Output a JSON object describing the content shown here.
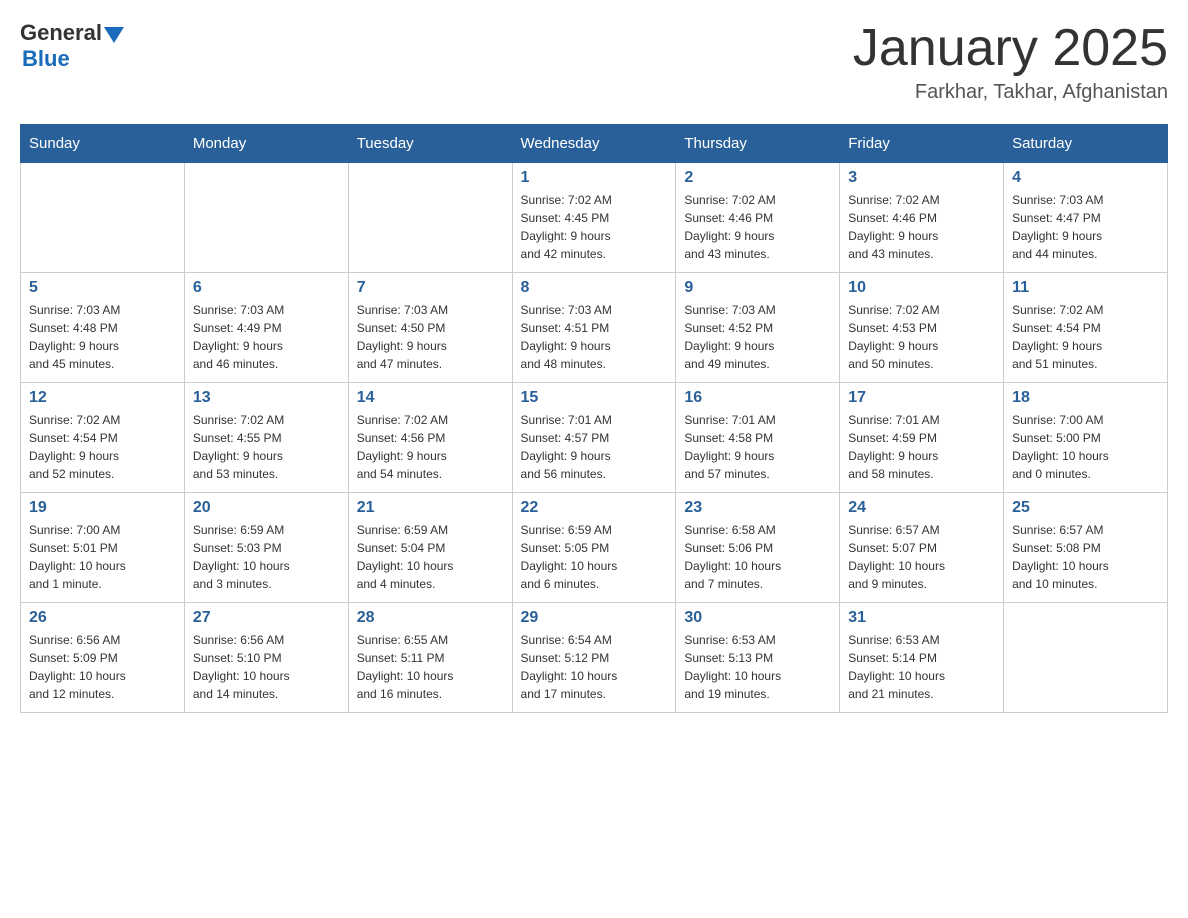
{
  "header": {
    "logo_general": "General",
    "logo_blue": "Blue",
    "month_title": "January 2025",
    "location": "Farkhar, Takhar, Afghanistan"
  },
  "days_of_week": [
    "Sunday",
    "Monday",
    "Tuesday",
    "Wednesday",
    "Thursday",
    "Friday",
    "Saturday"
  ],
  "weeks": [
    [
      {
        "day": "",
        "info": ""
      },
      {
        "day": "",
        "info": ""
      },
      {
        "day": "",
        "info": ""
      },
      {
        "day": "1",
        "info": "Sunrise: 7:02 AM\nSunset: 4:45 PM\nDaylight: 9 hours\nand 42 minutes."
      },
      {
        "day": "2",
        "info": "Sunrise: 7:02 AM\nSunset: 4:46 PM\nDaylight: 9 hours\nand 43 minutes."
      },
      {
        "day": "3",
        "info": "Sunrise: 7:02 AM\nSunset: 4:46 PM\nDaylight: 9 hours\nand 43 minutes."
      },
      {
        "day": "4",
        "info": "Sunrise: 7:03 AM\nSunset: 4:47 PM\nDaylight: 9 hours\nand 44 minutes."
      }
    ],
    [
      {
        "day": "5",
        "info": "Sunrise: 7:03 AM\nSunset: 4:48 PM\nDaylight: 9 hours\nand 45 minutes."
      },
      {
        "day": "6",
        "info": "Sunrise: 7:03 AM\nSunset: 4:49 PM\nDaylight: 9 hours\nand 46 minutes."
      },
      {
        "day": "7",
        "info": "Sunrise: 7:03 AM\nSunset: 4:50 PM\nDaylight: 9 hours\nand 47 minutes."
      },
      {
        "day": "8",
        "info": "Sunrise: 7:03 AM\nSunset: 4:51 PM\nDaylight: 9 hours\nand 48 minutes."
      },
      {
        "day": "9",
        "info": "Sunrise: 7:03 AM\nSunset: 4:52 PM\nDaylight: 9 hours\nand 49 minutes."
      },
      {
        "day": "10",
        "info": "Sunrise: 7:02 AM\nSunset: 4:53 PM\nDaylight: 9 hours\nand 50 minutes."
      },
      {
        "day": "11",
        "info": "Sunrise: 7:02 AM\nSunset: 4:54 PM\nDaylight: 9 hours\nand 51 minutes."
      }
    ],
    [
      {
        "day": "12",
        "info": "Sunrise: 7:02 AM\nSunset: 4:54 PM\nDaylight: 9 hours\nand 52 minutes."
      },
      {
        "day": "13",
        "info": "Sunrise: 7:02 AM\nSunset: 4:55 PM\nDaylight: 9 hours\nand 53 minutes."
      },
      {
        "day": "14",
        "info": "Sunrise: 7:02 AM\nSunset: 4:56 PM\nDaylight: 9 hours\nand 54 minutes."
      },
      {
        "day": "15",
        "info": "Sunrise: 7:01 AM\nSunset: 4:57 PM\nDaylight: 9 hours\nand 56 minutes."
      },
      {
        "day": "16",
        "info": "Sunrise: 7:01 AM\nSunset: 4:58 PM\nDaylight: 9 hours\nand 57 minutes."
      },
      {
        "day": "17",
        "info": "Sunrise: 7:01 AM\nSunset: 4:59 PM\nDaylight: 9 hours\nand 58 minutes."
      },
      {
        "day": "18",
        "info": "Sunrise: 7:00 AM\nSunset: 5:00 PM\nDaylight: 10 hours\nand 0 minutes."
      }
    ],
    [
      {
        "day": "19",
        "info": "Sunrise: 7:00 AM\nSunset: 5:01 PM\nDaylight: 10 hours\nand 1 minute."
      },
      {
        "day": "20",
        "info": "Sunrise: 6:59 AM\nSunset: 5:03 PM\nDaylight: 10 hours\nand 3 minutes."
      },
      {
        "day": "21",
        "info": "Sunrise: 6:59 AM\nSunset: 5:04 PM\nDaylight: 10 hours\nand 4 minutes."
      },
      {
        "day": "22",
        "info": "Sunrise: 6:59 AM\nSunset: 5:05 PM\nDaylight: 10 hours\nand 6 minutes."
      },
      {
        "day": "23",
        "info": "Sunrise: 6:58 AM\nSunset: 5:06 PM\nDaylight: 10 hours\nand 7 minutes."
      },
      {
        "day": "24",
        "info": "Sunrise: 6:57 AM\nSunset: 5:07 PM\nDaylight: 10 hours\nand 9 minutes."
      },
      {
        "day": "25",
        "info": "Sunrise: 6:57 AM\nSunset: 5:08 PM\nDaylight: 10 hours\nand 10 minutes."
      }
    ],
    [
      {
        "day": "26",
        "info": "Sunrise: 6:56 AM\nSunset: 5:09 PM\nDaylight: 10 hours\nand 12 minutes."
      },
      {
        "day": "27",
        "info": "Sunrise: 6:56 AM\nSunset: 5:10 PM\nDaylight: 10 hours\nand 14 minutes."
      },
      {
        "day": "28",
        "info": "Sunrise: 6:55 AM\nSunset: 5:11 PM\nDaylight: 10 hours\nand 16 minutes."
      },
      {
        "day": "29",
        "info": "Sunrise: 6:54 AM\nSunset: 5:12 PM\nDaylight: 10 hours\nand 17 minutes."
      },
      {
        "day": "30",
        "info": "Sunrise: 6:53 AM\nSunset: 5:13 PM\nDaylight: 10 hours\nand 19 minutes."
      },
      {
        "day": "31",
        "info": "Sunrise: 6:53 AM\nSunset: 5:14 PM\nDaylight: 10 hours\nand 21 minutes."
      },
      {
        "day": "",
        "info": ""
      }
    ]
  ]
}
